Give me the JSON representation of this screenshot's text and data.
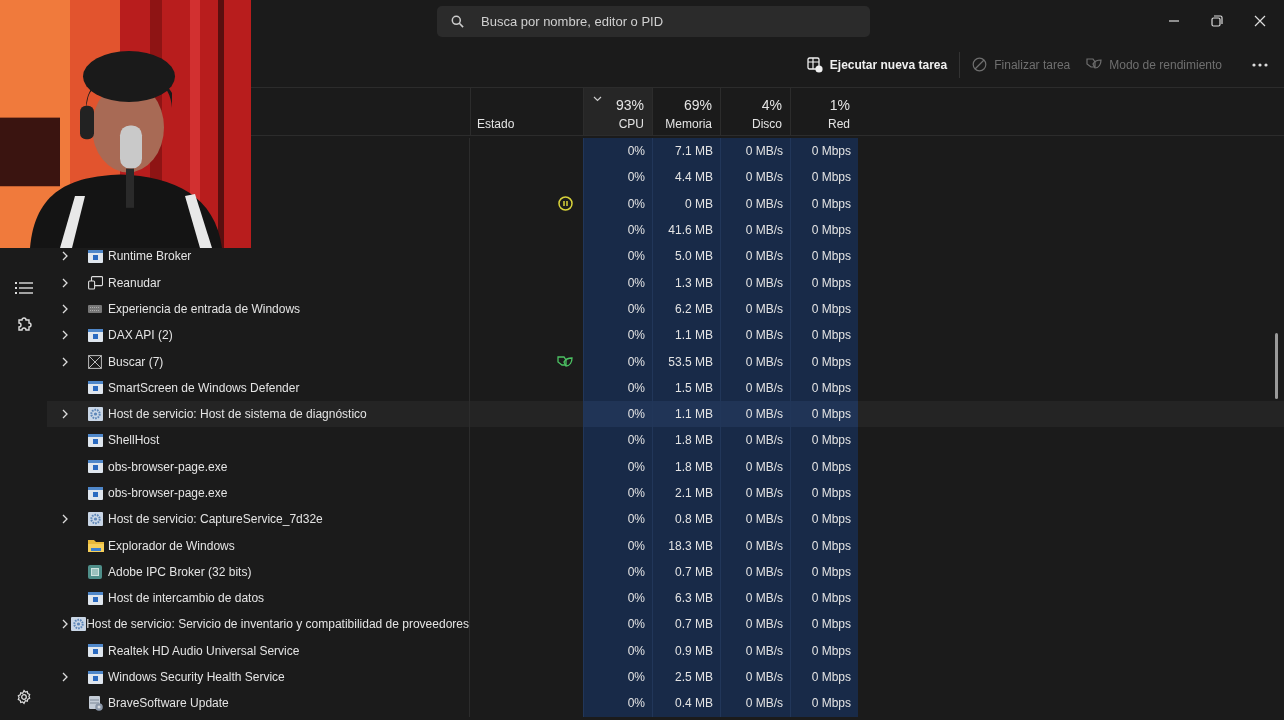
{
  "search": {
    "placeholder": "Busca por nombre, editor o PID"
  },
  "commands": [
    {
      "label": "Ejecutar nueva tarea",
      "kind": "run",
      "disabled": false
    },
    {
      "label": "Finalizar tarea",
      "kind": "stop",
      "disabled": true
    },
    {
      "label": "Modo de rendimiento",
      "kind": "leaf",
      "disabled": true
    }
  ],
  "columns": [
    {
      "label": "Estado"
    },
    {
      "label": "CPU",
      "percent": "93%",
      "sorted": true
    },
    {
      "label": "Memoria",
      "percent": "69%",
      "sorted": false
    },
    {
      "label": "Disco",
      "percent": "4%",
      "sorted": false
    },
    {
      "label": "Red",
      "percent": "1%",
      "sorted": false
    }
  ],
  "rows": [
    {
      "highlighted": false,
      "cpu": "0%",
      "memory": "7.1 MB",
      "disk": "0 MB/s",
      "network": "0 Mbps"
    },
    {
      "highlighted": false,
      "cpu": "0%",
      "memory": "4.4 MB",
      "disk": "0 MB/s",
      "network": "0 Mbps"
    },
    {
      "suspended": true,
      "highlighted": false,
      "cpu": "0%",
      "memory": "0 MB",
      "disk": "0 MB/s",
      "network": "0 Mbps"
    },
    {
      "highlighted": false,
      "cpu": "0%",
      "memory": "41.6 MB",
      "disk": "0 MB/s",
      "network": "0 Mbps"
    },
    {
      "name": "Runtime Broker",
      "kind": "app",
      "expandable": true,
      "highlighted": false,
      "cpu": "0%",
      "memory": "5.0 MB",
      "disk": "0 MB/s",
      "network": "0 Mbps"
    },
    {
      "name": "Reanudar",
      "kind": "window",
      "expandable": true,
      "highlighted": false,
      "cpu": "0%",
      "memory": "1.3 MB",
      "disk": "0 MB/s",
      "network": "0 Mbps"
    },
    {
      "name": "Experiencia de entrada de Windows",
      "kind": "keyboard",
      "expandable": true,
      "highlighted": false,
      "cpu": "0%",
      "memory": "6.2 MB",
      "disk": "0 MB/s",
      "network": "0 Mbps"
    },
    {
      "name": "DAX API (2)",
      "kind": "app",
      "expandable": true,
      "highlighted": false,
      "cpu": "0%",
      "memory": "1.1 MB",
      "disk": "0 MB/s",
      "network": "0 Mbps"
    },
    {
      "name": "Buscar (7)",
      "kind": "crossed",
      "expandable": true,
      "efficiency_mode": true,
      "highlighted": false,
      "cpu": "0%",
      "memory": "53.5 MB",
      "disk": "0 MB/s",
      "network": "0 Mbps"
    },
    {
      "name": "SmartScreen de Windows Defender",
      "kind": "app",
      "expandable": false,
      "highlighted": false,
      "cpu": "0%",
      "memory": "1.5 MB",
      "disk": "0 MB/s",
      "network": "0 Mbps"
    },
    {
      "name": "Host de servicio: Host de sistema de diagnóstico",
      "kind": "service",
      "expandable": true,
      "highlighted": true,
      "cpu": "0%",
      "memory": "1.1 MB",
      "disk": "0 MB/s",
      "network": "0 Mbps"
    },
    {
      "name": "ShellHost",
      "kind": "app",
      "expandable": false,
      "highlighted": false,
      "cpu": "0%",
      "memory": "1.8 MB",
      "disk": "0 MB/s",
      "network": "0 Mbps"
    },
    {
      "name": "obs-browser-page.exe",
      "kind": "app",
      "expandable": false,
      "highlighted": false,
      "cpu": "0%",
      "memory": "1.8 MB",
      "disk": "0 MB/s",
      "network": "0 Mbps"
    },
    {
      "name": "obs-browser-page.exe",
      "kind": "app",
      "expandable": false,
      "highlighted": false,
      "cpu": "0%",
      "memory": "2.1 MB",
      "disk": "0 MB/s",
      "network": "0 Mbps"
    },
    {
      "name": "Host de servicio: CaptureService_7d32e",
      "kind": "service",
      "expandable": true,
      "highlighted": false,
      "cpu": "0%",
      "memory": "0.8 MB",
      "disk": "0 MB/s",
      "network": "0 Mbps"
    },
    {
      "name": "Explorador de Windows",
      "kind": "folder",
      "expandable": false,
      "highlighted": false,
      "cpu": "0%",
      "memory": "18.3 MB",
      "disk": "0 MB/s",
      "network": "0 Mbps"
    },
    {
      "name": "Adobe IPC Broker (32 bits)",
      "kind": "broker",
      "expandable": false,
      "highlighted": false,
      "cpu": "0%",
      "memory": "0.7 MB",
      "disk": "0 MB/s",
      "network": "0 Mbps"
    },
    {
      "name": "Host de intercambio de datos",
      "kind": "app",
      "expandable": false,
      "highlighted": false,
      "cpu": "0%",
      "memory": "6.3 MB",
      "disk": "0 MB/s",
      "network": "0 Mbps"
    },
    {
      "name": "Host de servicio: Servicio de inventario y compatibilidad de proveedores",
      "kind": "service",
      "expandable": true,
      "highlighted": false,
      "cpu": "0%",
      "memory": "0.7 MB",
      "disk": "0 MB/s",
      "network": "0 Mbps"
    },
    {
      "name": "Realtek HD Audio Universal Service",
      "kind": "app",
      "expandable": false,
      "highlighted": false,
      "cpu": "0%",
      "memory": "0.9 MB",
      "disk": "0 MB/s",
      "network": "0 Mbps"
    },
    {
      "name": "Windows Security Health Service",
      "kind": "app",
      "expandable": true,
      "highlighted": false,
      "cpu": "0%",
      "memory": "2.5 MB",
      "disk": "0 MB/s",
      "network": "0 Mbps"
    },
    {
      "name": "BraveSoftware Update",
      "kind": "installer",
      "expandable": false,
      "highlighted": false,
      "cpu": "0%",
      "memory": "0.4 MB",
      "disk": "0 MB/s",
      "network": "0 Mbps"
    }
  ]
}
